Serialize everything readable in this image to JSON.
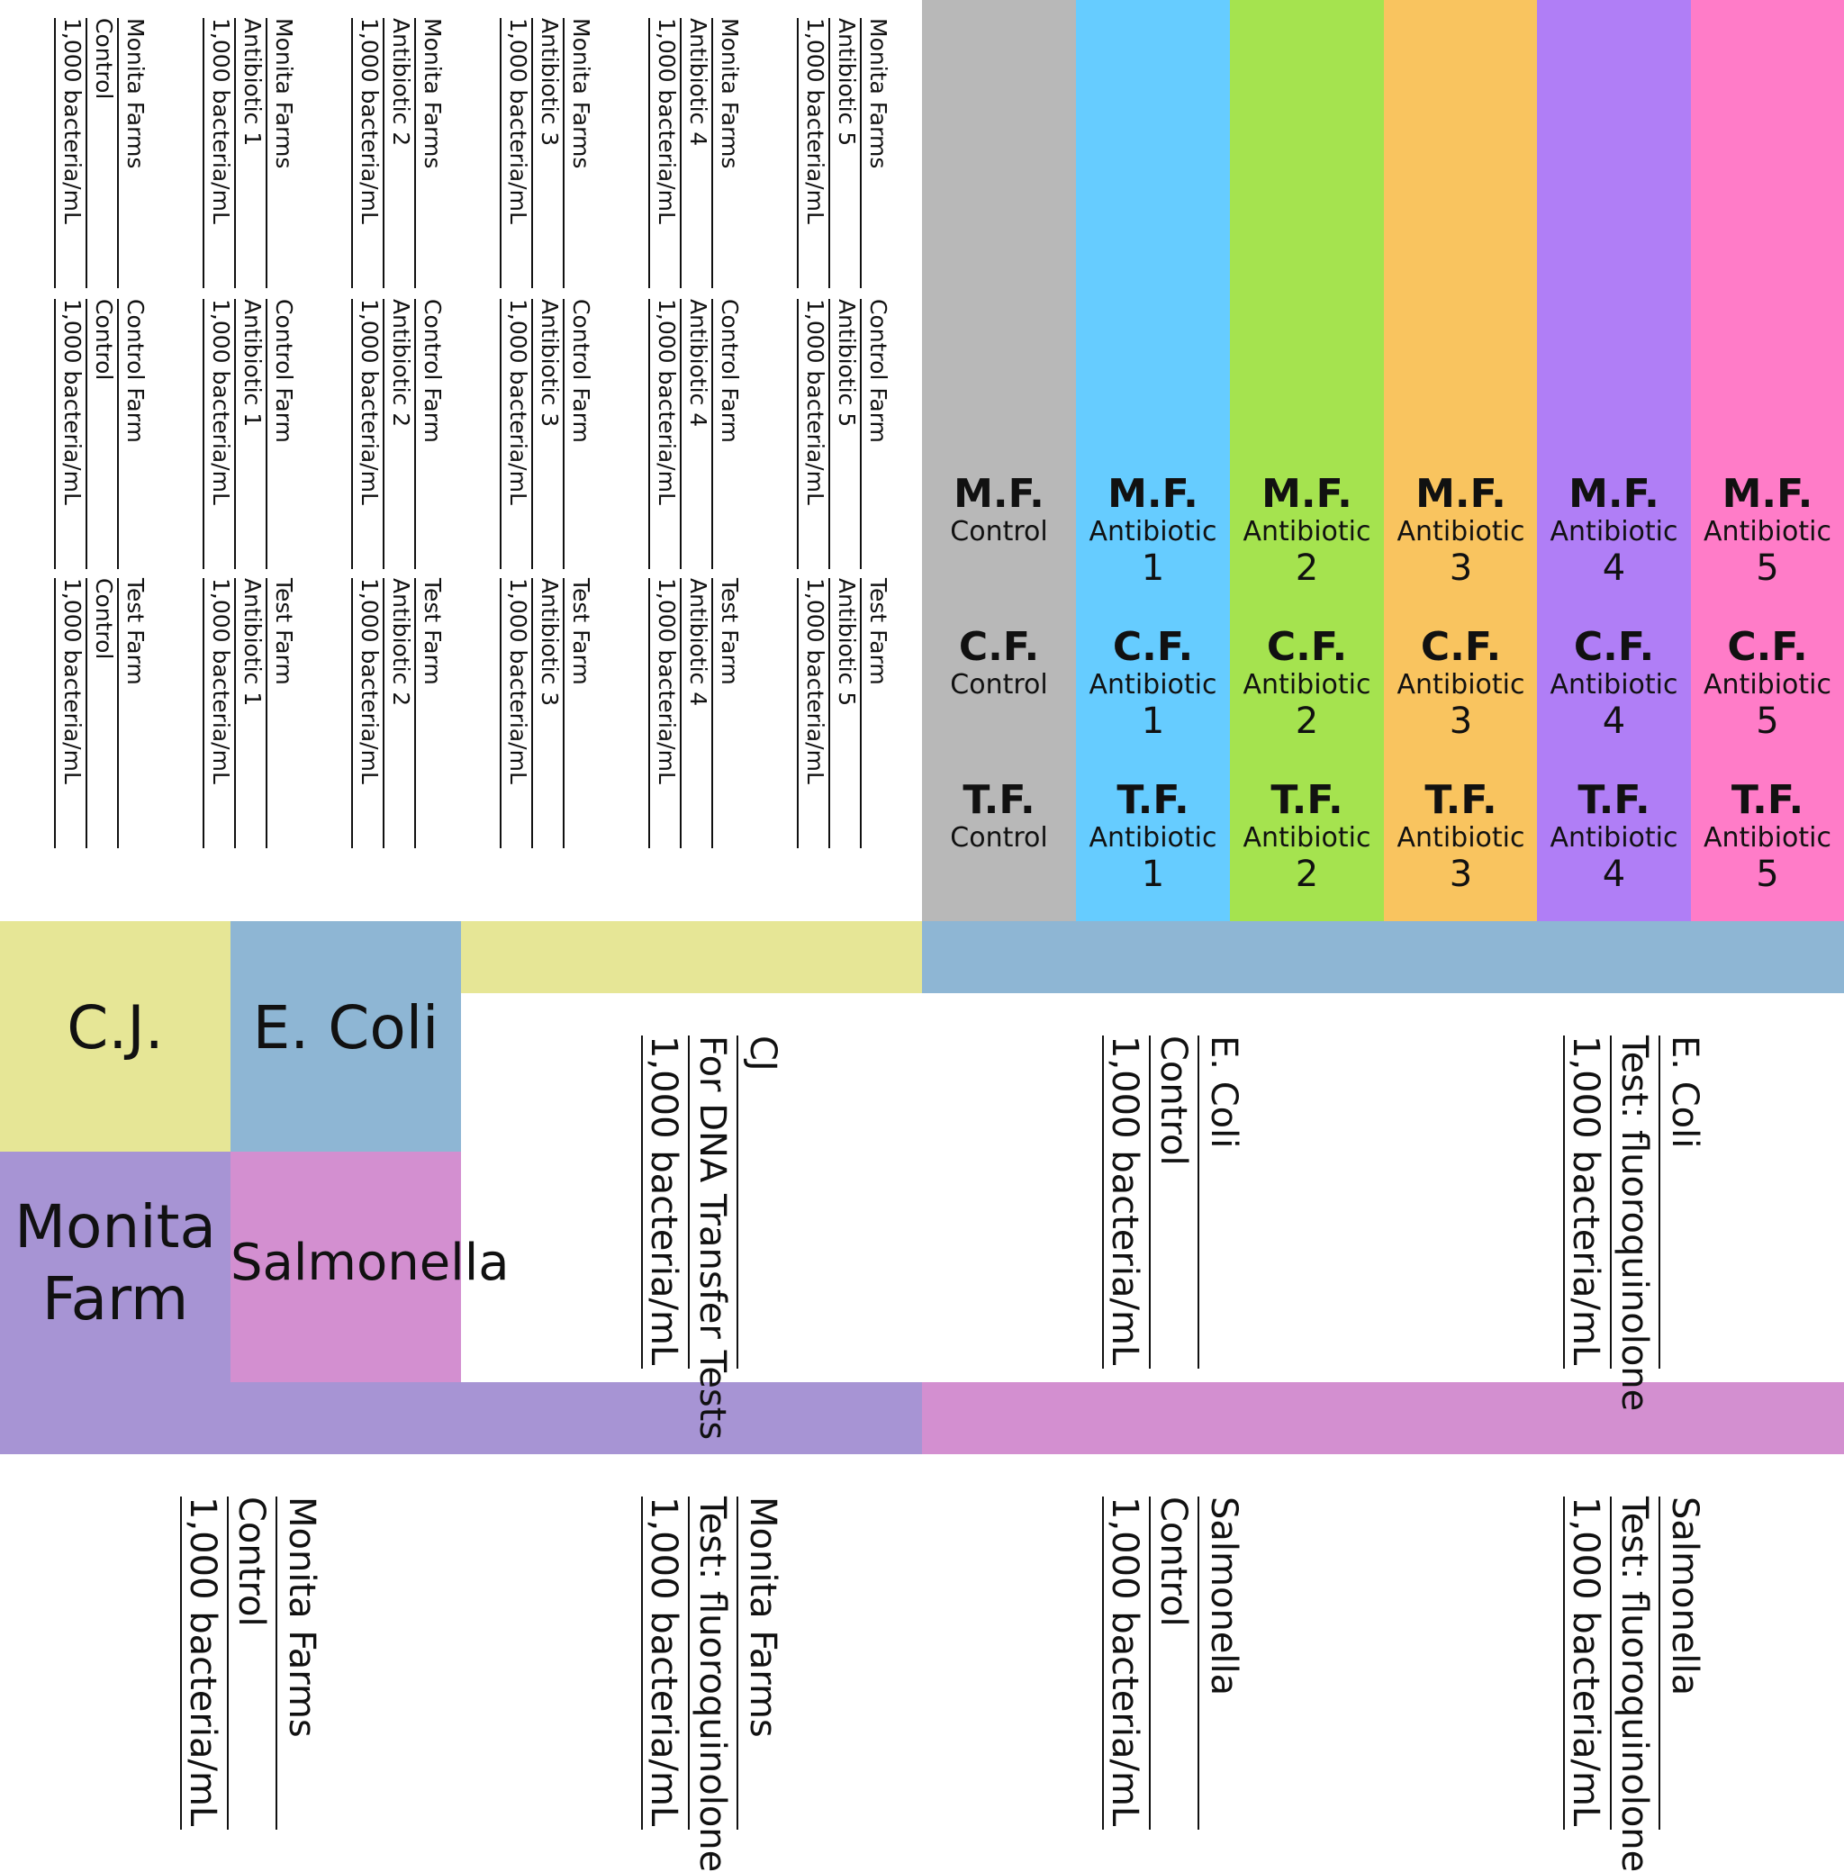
{
  "colors": {
    "gray": "#b8b8b8",
    "blue": "#66ccff",
    "green": "#a5e34f",
    "orange": "#f9c45f",
    "purple": "#b07ef6",
    "pink": "#ff7cc8",
    "cj": "#e6e696",
    "ecoli": "#8eb6d4",
    "monita": "#a794d4",
    "salmonella": "#d38fd0"
  },
  "monita_labels": [
    {
      "farm": "Monita Farms",
      "sample": "Control",
      "conc": "1,000 bacteria/mL"
    },
    {
      "farm": "Monita Farms",
      "sample": "Antibiotic 1",
      "conc": "1,000 bacteria/mL"
    },
    {
      "farm": "Monita Farms",
      "sample": "Antibiotic 2",
      "conc": "1,000 bacteria/mL"
    },
    {
      "farm": "Monita Farms",
      "sample": "Antibiotic 3",
      "conc": "1,000 bacteria/mL"
    },
    {
      "farm": "Monita Farms",
      "sample": "Antibiotic 4",
      "conc": "1,000 bacteria/mL"
    },
    {
      "farm": "Monita Farms",
      "sample": "Antibiotic 5",
      "conc": "1,000 bacteria/mL"
    }
  ],
  "control_labels": [
    {
      "farm": "Control Farm",
      "sample": "Control",
      "conc": "1,000 bacteria/mL"
    },
    {
      "farm": "Control Farm",
      "sample": "Antibiotic 1",
      "conc": "1,000 bacteria/mL"
    },
    {
      "farm": "Control Farm",
      "sample": "Antibiotic 2",
      "conc": "1,000 bacteria/mL"
    },
    {
      "farm": "Control Farm",
      "sample": "Antibiotic 3",
      "conc": "1,000 bacteria/mL"
    },
    {
      "farm": "Control Farm",
      "sample": "Antibiotic 4",
      "conc": "1,000 bacteria/mL"
    },
    {
      "farm": "Control Farm",
      "sample": "Antibiotic 5",
      "conc": "1,000 bacteria/mL"
    }
  ],
  "test_labels": [
    {
      "farm": "Test Farm",
      "sample": "Control",
      "conc": "1,000 bacteria/mL"
    },
    {
      "farm": "Test Farm",
      "sample": "Antibiotic 1",
      "conc": "1,000 bacteria/mL"
    },
    {
      "farm": "Test Farm",
      "sample": "Antibiotic 2",
      "conc": "1,000 bacteria/mL"
    },
    {
      "farm": "Test Farm",
      "sample": "Antibiotic 3",
      "conc": "1,000 bacteria/mL"
    },
    {
      "farm": "Test Farm",
      "sample": "Antibiotic 4",
      "conc": "1,000 bacteria/mL"
    },
    {
      "farm": "Test Farm",
      "sample": "Antibiotic 5",
      "conc": "1,000 bacteria/mL"
    }
  ],
  "columns": [
    {
      "color": "gray",
      "mf": "M.F.",
      "cf": "C.F.",
      "tf": "T.F.",
      "sub": "Control",
      "num": ""
    },
    {
      "color": "blue",
      "mf": "M.F.",
      "cf": "C.F.",
      "tf": "T.F.",
      "sub": "Antibiotic",
      "num": "1"
    },
    {
      "color": "green",
      "mf": "M.F.",
      "cf": "C.F.",
      "tf": "T.F.",
      "sub": "Antibiotic",
      "num": "2"
    },
    {
      "color": "orange",
      "mf": "M.F.",
      "cf": "C.F.",
      "tf": "T.F.",
      "sub": "Antibiotic",
      "num": "3"
    },
    {
      "color": "purple",
      "mf": "M.F.",
      "cf": "C.F.",
      "tf": "T.F.",
      "sub": "Antibiotic",
      "num": "4"
    },
    {
      "color": "pink",
      "mf": "M.F.",
      "cf": "C.F.",
      "tf": "T.F.",
      "sub": "Antibiotic",
      "num": "5"
    }
  ],
  "blocks": {
    "cj": "C.J.",
    "ecoli": "E. Coli",
    "monita_line1": "Monita",
    "monita_line2": "Farm",
    "salmonella": "Salmonella"
  },
  "big_labels_row1": [
    {
      "title": "CJ",
      "sample": "For DNA Transfer Tests",
      "conc": "1,000 bacteria/mL"
    },
    {
      "title": "E. Coli",
      "sample": "Control",
      "conc": "1,000 bacteria/mL"
    },
    {
      "title": "E. Coli",
      "sample": "Test: fluoroquinolone",
      "conc": "1,000 bacteria/mL"
    }
  ],
  "big_labels_row2": [
    {
      "title": "Monita Farms",
      "sample": "Control",
      "conc": "1,000 bacteria/mL"
    },
    {
      "title": "Monita Farms",
      "sample": "Test: fluoroquinolone",
      "conc": "1,000 bacteria/mL"
    },
    {
      "title": "Salmonella",
      "sample": "Control",
      "conc": "1,000 bacteria/mL"
    },
    {
      "title": "Salmonella",
      "sample": "Test: fluoroquinolone",
      "conc": "1,000 bacteria/mL"
    }
  ]
}
